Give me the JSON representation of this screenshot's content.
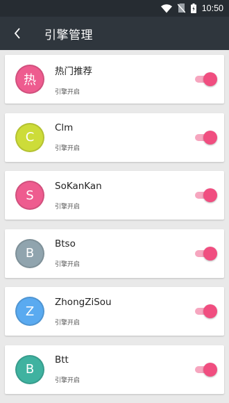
{
  "status_bar": {
    "time": "10:50"
  },
  "toolbar": {
    "title": "引擎管理"
  },
  "engines": [
    {
      "name": "热门推荐",
      "avatar_text": "热",
      "avatar_color": "#ee5c8f",
      "status": "引擎开启",
      "enabled": true
    },
    {
      "name": "Clm",
      "avatar_text": "C",
      "avatar_color": "#cddc39",
      "status": "引擎开启",
      "enabled": true
    },
    {
      "name": "SoKanKan",
      "avatar_text": "S",
      "avatar_color": "#ee5c8f",
      "status": "引擎开启",
      "enabled": true
    },
    {
      "name": "Btso",
      "avatar_text": "B",
      "avatar_color": "#90a4ae",
      "status": "引擎开启",
      "enabled": true
    },
    {
      "name": "ZhongZiSou",
      "avatar_text": "Z",
      "avatar_color": "#5aaaf0",
      "status": "引擎开启",
      "enabled": true
    },
    {
      "name": "Btt",
      "avatar_text": "B",
      "avatar_color": "#3fb2a0",
      "status": "引擎开启",
      "enabled": true
    }
  ],
  "colors": {
    "switch_on": "#f04e80",
    "switch_track": "#f6a6bf",
    "toolbar": "#2f363d"
  }
}
